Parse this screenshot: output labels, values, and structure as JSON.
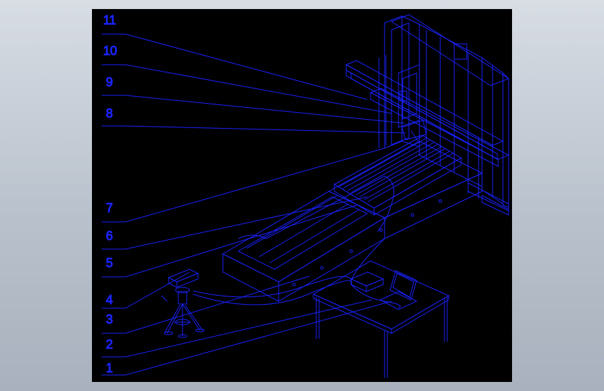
{
  "drawing": {
    "line_color": "#1a22ff",
    "background": "#000000",
    "callouts": [
      "11",
      "10",
      "9",
      "8",
      "7",
      "6",
      "5",
      "4",
      "3",
      "2",
      "1"
    ]
  }
}
